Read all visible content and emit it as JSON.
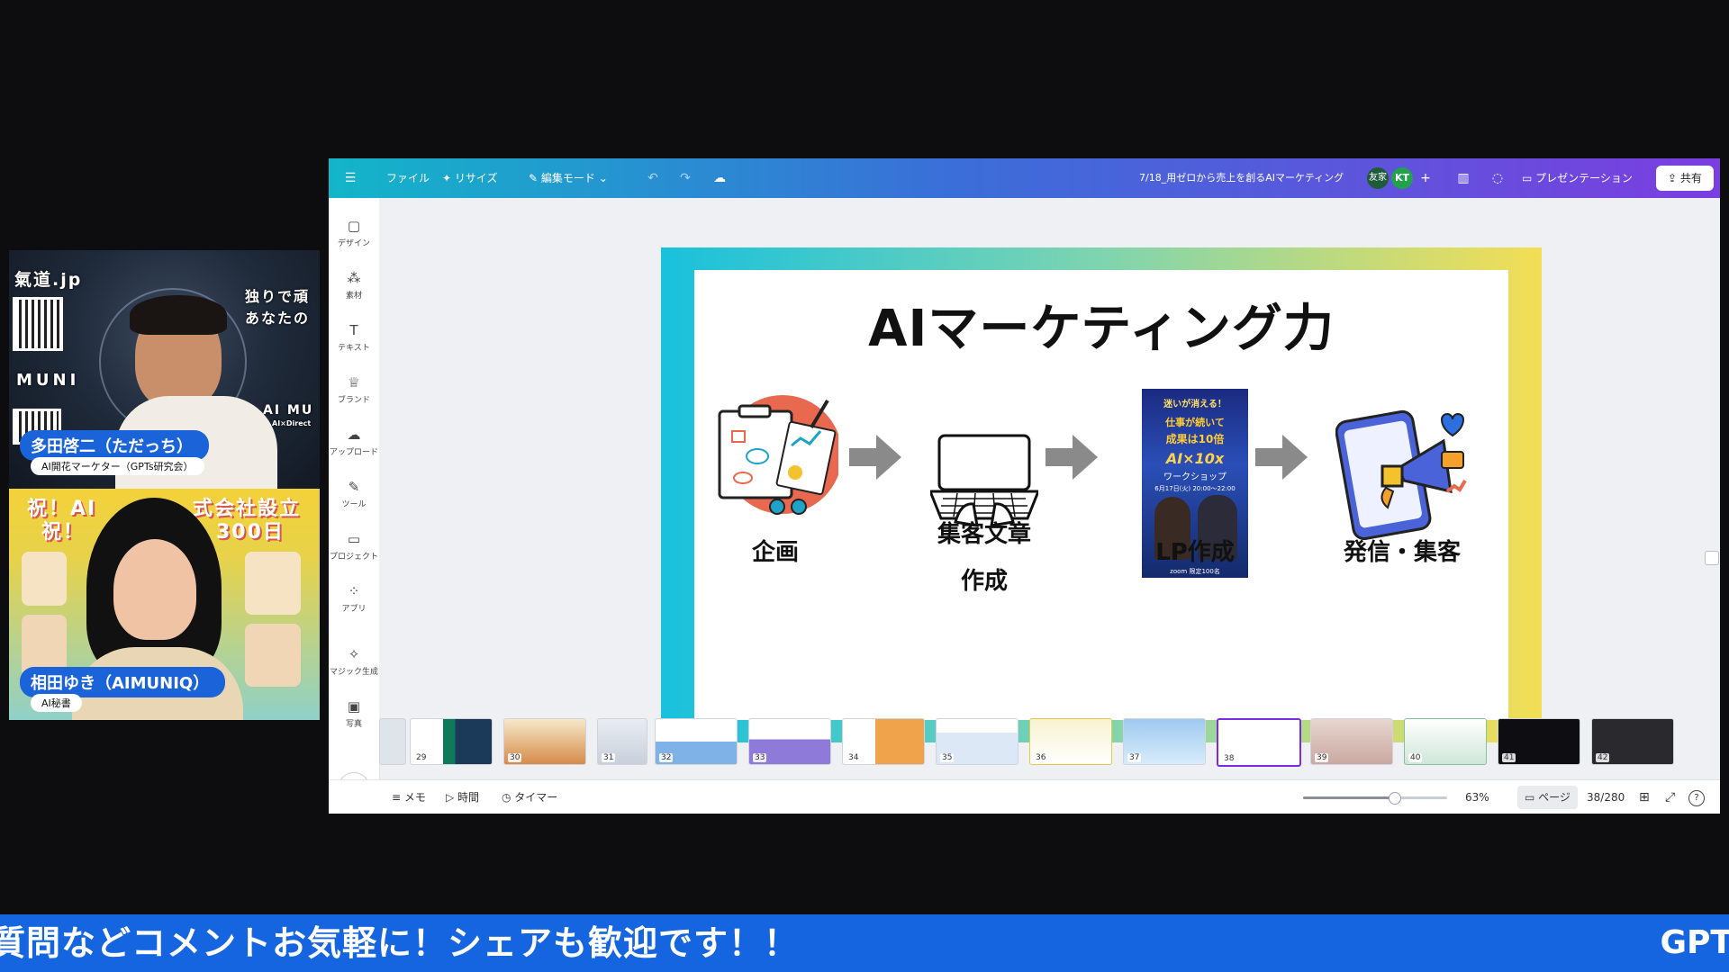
{
  "tile_presenter_1": {
    "brand_text": "氣道.jp",
    "side_text_1": "独りで頑",
    "side_text_2": "あなたの",
    "logo_text": "MUNI",
    "logo_text_2": "AI MU",
    "logo_sub": "AI×Direct",
    "name": "多田啓二（ただっち）",
    "role": "AI開花マーケター（GPTs研究会）"
  },
  "tile_presenter_2": {
    "banner_text_1": "祝！AI",
    "banner_text_2": "式会社設立",
    "banner_text_3": "祝！",
    "banner_text_4": "300日",
    "name": "相田ゆき（AIMUNIQ）",
    "role": "AI秘書"
  },
  "topbar": {
    "menu_file": "ファイル",
    "menu_resize": "リサイズ",
    "menu_edit_mode": "編集モード",
    "doc_title": "7/18_用ゼロから売上を創るAIマーケティング",
    "avatar_1": "友家",
    "avatar_2": "KT",
    "present_label": "プレゼンテーション",
    "share_label": "共有"
  },
  "sidebar": {
    "items": [
      {
        "label": "デザイン",
        "icon": "layout-icon"
      },
      {
        "label": "素材",
        "icon": "elements-icon"
      },
      {
        "label": "テキスト",
        "icon": "text-icon"
      },
      {
        "label": "ブランド",
        "icon": "brand-icon"
      },
      {
        "label": "アップロード",
        "icon": "upload-icon"
      },
      {
        "label": "ツール",
        "icon": "draw-icon"
      },
      {
        "label": "プロジェクト",
        "icon": "folder-icon"
      },
      {
        "label": "アプリ",
        "icon": "apps-icon"
      },
      {
        "label": "マジック生成",
        "icon": "magic-icon"
      },
      {
        "label": "写真",
        "icon": "photo-icon"
      }
    ]
  },
  "slide": {
    "title": "AIマーケティング力",
    "steps": [
      {
        "label": "企画",
        "icon": "planning-clipboard-icon"
      },
      {
        "label": "集客文章作成",
        "line1": "集客文章",
        "line2": "作成",
        "icon": "laptop-typing-icon"
      },
      {
        "label": "LP作成",
        "icon": "landing-page-poster-icon"
      },
      {
        "label": "発信・集客",
        "icon": "megaphone-phone-icon"
      }
    ],
    "poster": {
      "line1": "迷いが消える！",
      "line2": "仕事が続いて",
      "line3": "成果は10倍",
      "line4": "AI×10x",
      "line5": "ワークショップ",
      "line6": "6月17日(火) 20:00〜22:00",
      "footer": "zoom 限定100名"
    }
  },
  "filmstrip": {
    "pages": [
      "29",
      "30",
      "31",
      "32",
      "33",
      "34",
      "35",
      "36",
      "37",
      "38",
      "39",
      "40",
      "41",
      "42"
    ],
    "active_page": "38"
  },
  "bottombar": {
    "notes": "メモ",
    "duration": "時間",
    "timer": "タイマー",
    "zoom": "63%",
    "zoom_level": 0.63,
    "pages_label": "ページ",
    "page_counter": "38/280"
  },
  "ticker": {
    "text": "質問などコメントお気軽に！シェアも歓迎です！！",
    "right_text": "GPT"
  },
  "colors": {
    "ticker_bg": "#1565e0",
    "name_pill": "#1a63d8",
    "canva_gradient_start": "#13b5c9",
    "canva_gradient_end": "#7b3ee0",
    "step_arrow": "#8a8a8a"
  }
}
